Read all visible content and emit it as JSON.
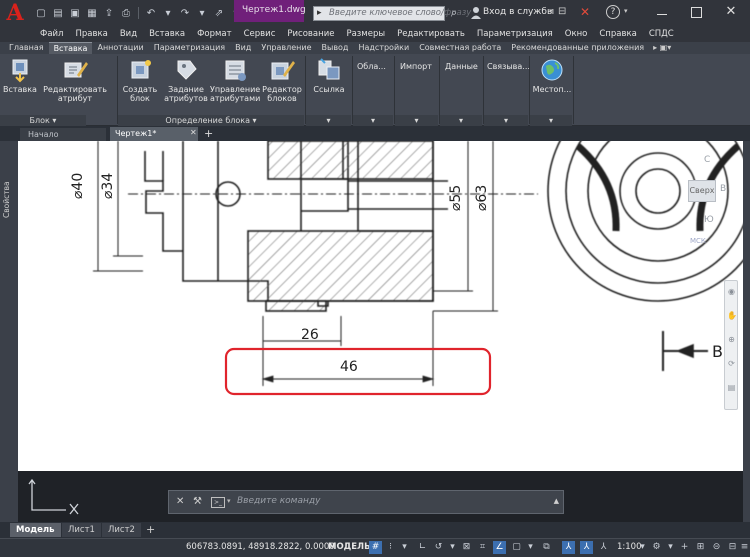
{
  "title_bar": {
    "document_title": "Чертеж1.dwg",
    "search_placeholder": "Введите ключевое слово/фразу",
    "login_label": "Вход в службы",
    "help": "?"
  },
  "menu": [
    "Файл",
    "Правка",
    "Вид",
    "Вставка",
    "Формат",
    "Сервис",
    "Рисование",
    "Размеры",
    "Редактировать",
    "Параметризация",
    "Окно",
    "Справка",
    "СПДС"
  ],
  "ribbon_tabs": [
    "Главная",
    "Вставка",
    "Аннотации",
    "Параметризация",
    "Вид",
    "Управление",
    "Вывод",
    "Надстройки",
    "Совместная работа",
    "Рекомендованные приложения"
  ],
  "active_ribbon_tab": "Вставка",
  "ribbon": {
    "block_panel": {
      "title": "Блок",
      "tools": [
        {
          "label": "Вставка"
        },
        {
          "label": "Редактировать\nатрибут"
        }
      ]
    },
    "block_def_panel": {
      "title": "Определение блока",
      "tools": [
        {
          "label": "Создать\nблок"
        },
        {
          "label": "Задание\nатрибутов"
        },
        {
          "label": "Управление\nатрибутами"
        },
        {
          "label": "Редактор\nблоков"
        }
      ]
    },
    "link_tool": {
      "label": "Ссылка"
    },
    "drop_panels": [
      "Обла...",
      "Импорт",
      "Данные",
      "Связыва..."
    ],
    "location_tool": {
      "label": "Местоп..."
    }
  },
  "file_tabs": {
    "start": "Начало",
    "drawing": "Чертеж1*"
  },
  "side_panel_label": "Свойства",
  "drawing": {
    "dimensions": [
      "⌀40",
      "⌀34",
      "⌀55",
      "⌀63",
      "26",
      "46"
    ],
    "section_label": "B",
    "viewcube": {
      "north": "С",
      "east": "В",
      "south": "Ю",
      "top": "Сверх",
      "ucs": "МСК"
    }
  },
  "command_line": {
    "placeholder": "Введите команду"
  },
  "layout_tabs": [
    "Модель",
    "Лист1",
    "Лист2"
  ],
  "status_bar": {
    "coordinates": "606783.0891, 48918.2822, 0.0000",
    "space": "МОДЕЛЬ",
    "scale": "1:100"
  },
  "colors": {
    "accent_title": "#70207a",
    "highlight_box": "#e0242c",
    "status_active": "#3c6fb0",
    "logo": "#d9221c"
  }
}
